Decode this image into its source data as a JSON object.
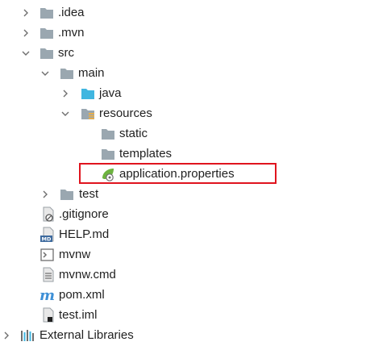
{
  "tree": {
    "items": [
      {
        "label": ".idea",
        "icon": "folder-icon",
        "expanded": false
      },
      {
        "label": ".mvn",
        "icon": "folder-icon",
        "expanded": false
      },
      {
        "label": "src",
        "icon": "folder-icon",
        "expanded": true
      },
      {
        "label": "main",
        "icon": "folder-icon",
        "expanded": true
      },
      {
        "label": "java",
        "icon": "source-folder-icon",
        "expanded": false
      },
      {
        "label": "resources",
        "icon": "resources-folder-icon",
        "expanded": true
      },
      {
        "label": "static",
        "icon": "folder-icon"
      },
      {
        "label": "templates",
        "icon": "folder-icon"
      },
      {
        "label": "application.properties",
        "icon": "spring-properties-icon"
      },
      {
        "label": "test",
        "icon": "folder-icon",
        "expanded": false
      },
      {
        "label": ".gitignore",
        "icon": "ignore-file-icon"
      },
      {
        "label": "HELP.md",
        "icon": "markdown-file-icon"
      },
      {
        "label": "mvnw",
        "icon": "script-file-icon"
      },
      {
        "label": "mvnw.cmd",
        "icon": "text-file-icon"
      },
      {
        "label": "pom.xml",
        "icon": "maven-icon"
      },
      {
        "label": "test.iml",
        "icon": "iml-file-icon"
      },
      {
        "label": "External Libraries",
        "icon": "libraries-icon",
        "expanded": false
      }
    ]
  },
  "colors": {
    "folder": "#9aa7b0",
    "source_folder": "#40b6e0",
    "resources_accent": "#f4af3d",
    "highlight": "#e0141e",
    "spring_green": "#6db33f",
    "maven_blue": "#3d8fd6"
  }
}
